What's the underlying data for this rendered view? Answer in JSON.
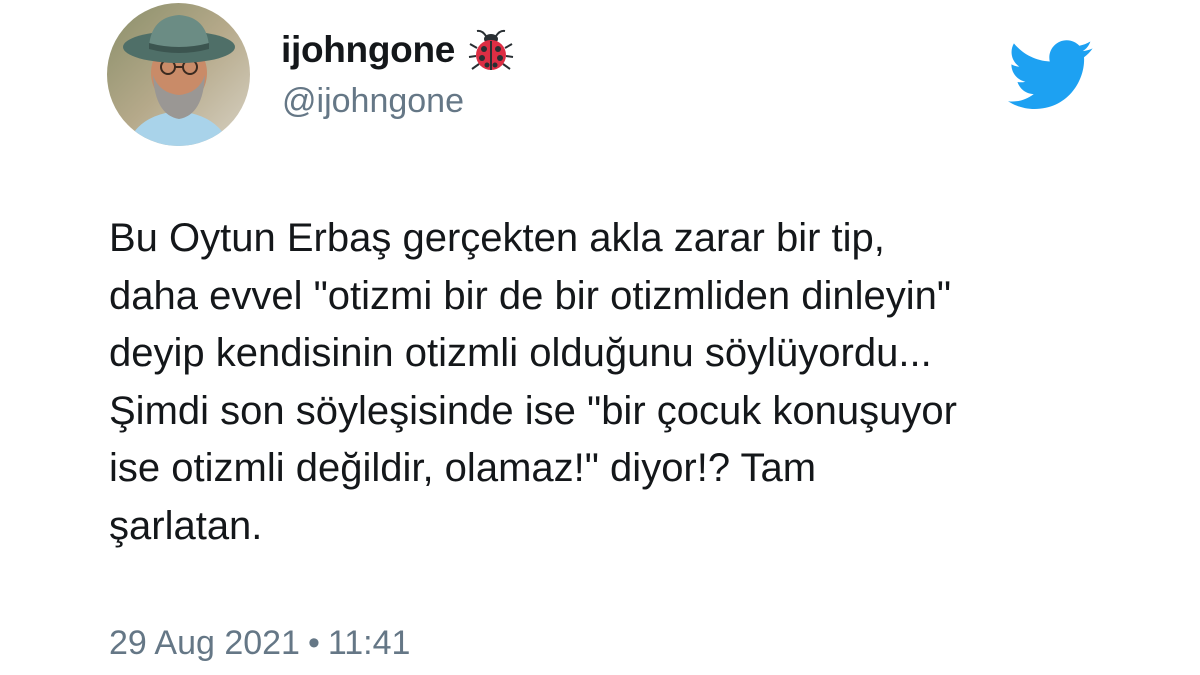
{
  "tweet": {
    "author": {
      "display_name": "ijohngone",
      "name_emoji": "ladybug-icon",
      "handle": "@ijohngone",
      "avatar": "avatar-photo"
    },
    "brand_icon": "twitter-bird-icon",
    "brand_color": "#1DA1F2",
    "text_lines": [
      "Bu Oytun Erbaş gerçekten akla zarar bir tip,",
      "daha evvel \"otizmi bir de bir otizmliden dinleyin\"",
      "deyip kendisinin otizmli olduğunu söylüyordu...",
      "Şimdi son söyleşisinde ise \"bir çocuk konuşuyor",
      "ise otizmli değildir, olamaz!\" diyor!? Tam",
      "şarlatan."
    ],
    "date": "29 Aug 2021",
    "separator": "•",
    "time": "11:41"
  },
  "colors": {
    "text": "#14171A",
    "secondary": "#657786",
    "background": "#FFFFFF"
  }
}
